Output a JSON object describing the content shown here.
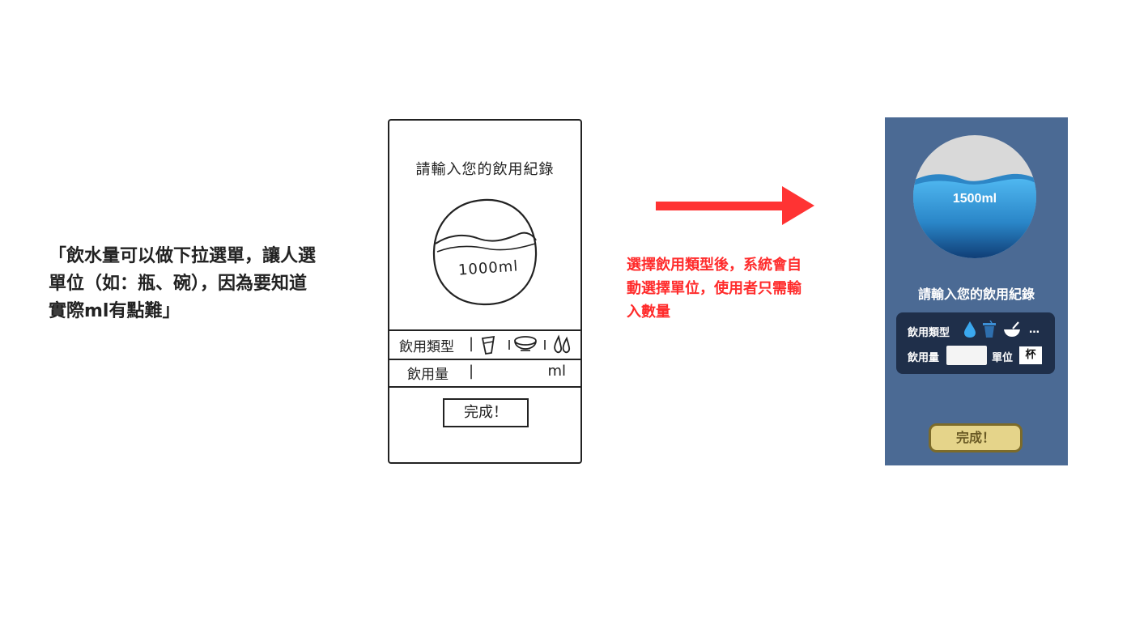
{
  "left_quote": {
    "lines": [
      "「飲水量可以做下拉選單，讓人選",
      "單位（如：瓶、碗），因為要知道",
      "實際ml有點難」"
    ]
  },
  "sketch": {
    "title": "請輸入您的飲用紀錄",
    "circle_amount": "1000ml",
    "type_label": "飲用類型",
    "amount_label": "飲用量",
    "separator": "|",
    "unit": "ml",
    "done_button": "完成！",
    "icons": [
      "cup-icon",
      "bowl-icon",
      "drops-icon"
    ]
  },
  "arrow": {
    "color": "#ff3333"
  },
  "note": {
    "lines": [
      "選擇飲用類型後，系統會自",
      "動選擇單位，使用者只需輸",
      "入數量"
    ],
    "color": "#ff2b2b"
  },
  "app": {
    "background": "#4b6a94",
    "amount": "1500ml",
    "title": "請輸入您的飲用紀錄",
    "type_label": "飲用類型",
    "type_icons": [
      "water-drop-icon",
      "cup-icon",
      "bowl-icon"
    ],
    "more": "…",
    "amount_label": "飲用量",
    "amount_value": "",
    "unit_label": "單位",
    "unit_value": "杯",
    "done_button": "完成！",
    "panel_color": "#1f2f4a",
    "button_color": "#e5d48a"
  }
}
